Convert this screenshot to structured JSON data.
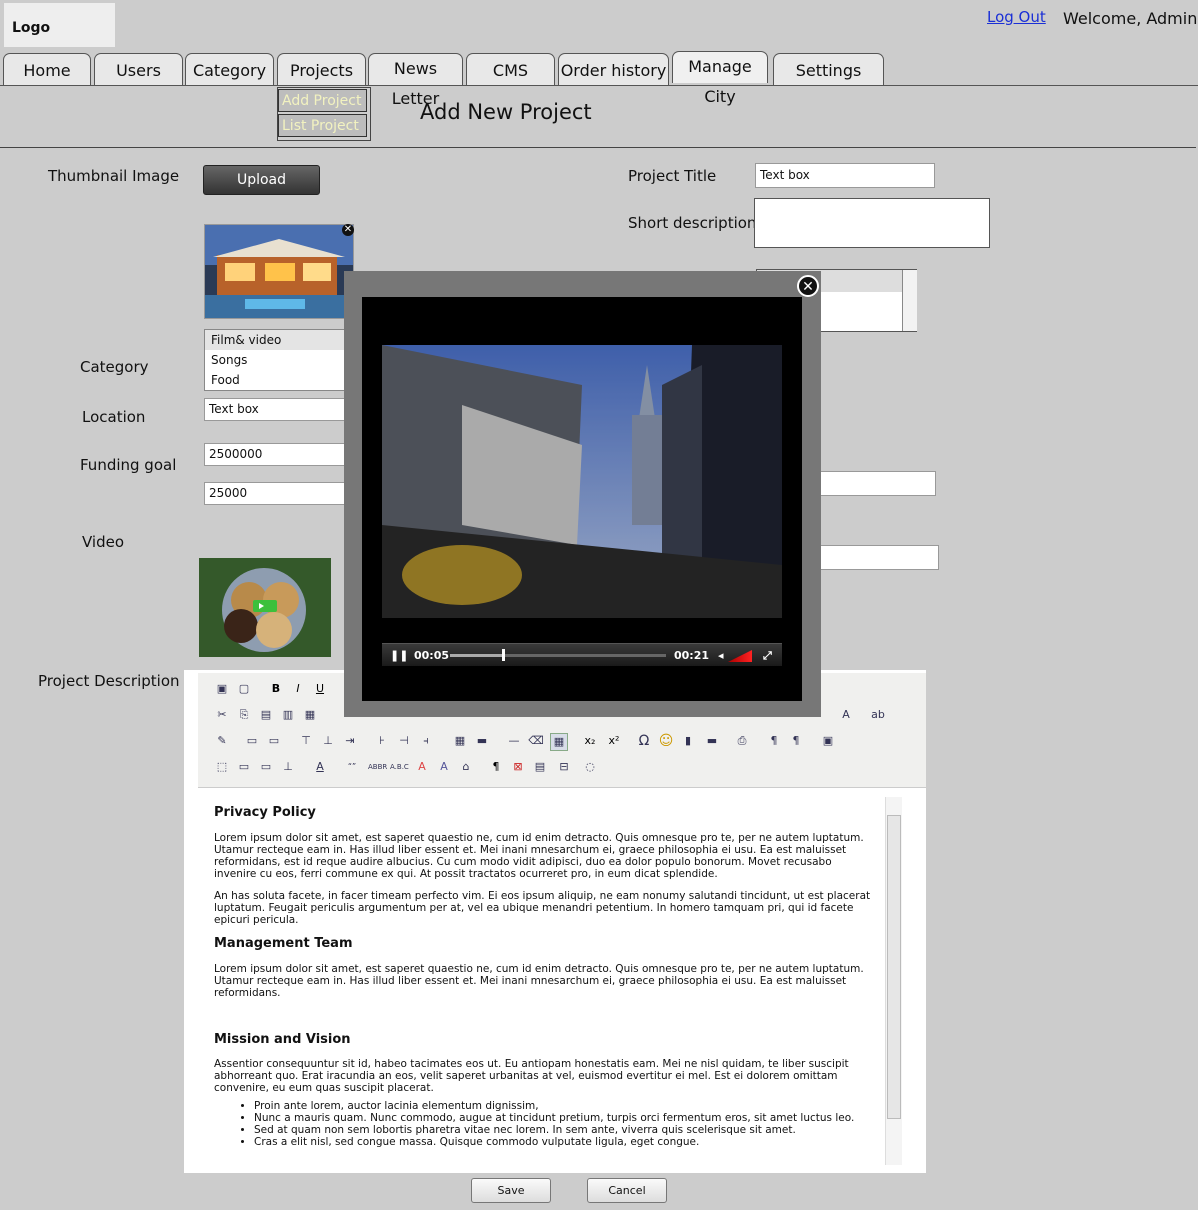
{
  "header": {
    "logo": "Logo",
    "logout": "Log Out",
    "welcome": "Welcome, Admin"
  },
  "nav": {
    "tabs": [
      "Home",
      "Users",
      "Category",
      "Projects",
      "News Letter",
      "CMS",
      "Order history",
      "Manage City",
      "Settings"
    ],
    "submenu": [
      "Add Project",
      "List Project"
    ]
  },
  "page": {
    "title": "Add New Project"
  },
  "form": {
    "thumbnail_label": "Thumbnail Image",
    "upload_label": "Upload",
    "project_title_label": "Project Title",
    "project_title_value": "Text box",
    "short_desc_label": "Short description",
    "category_label": "Category",
    "category_options": [
      "Film& video",
      "Songs",
      "Food"
    ],
    "location_label": "Location",
    "location_value": "Text box",
    "funding_label": "Funding goal",
    "funding_value": "2500000",
    "funding_value2": "25000",
    "video_label": "Video",
    "project_desc_label": "Project Description",
    "save_label": "Save",
    "cancel_label": "Cancel"
  },
  "editor": {
    "h1": "Privacy Policy",
    "p1": "Lorem ipsum dolor sit amet, est saperet quaestio ne, cum id enim detracto. Quis omnesque pro te, per ne autem luptatum. Utamur recteque eam in. Has illud liber essent et. Mei inani mnesarchum ei, graece philosophia ei usu. Ea est maluisset reformidans, est id reque audire albucius. Cu cum modo vidit adipisci, duo ea dolor populo bonorum. Movet recusabo invenire cu eos, ferri commune ex qui. At possit tractatos ocurreret pro, in eum dicat splendide.",
    "p2": "An has soluta facete, in facer timeam perfecto vim. Ei eos ipsum aliquip, ne eam nonumy salutandi tincidunt, ut est placerat luptatum. Feugait periculis argumentum per at, vel ea ubique menandri petentium. In homero tamquam pri, qui id facete epicuri pericula.",
    "h2": "Management Team",
    "p3": "Lorem ipsum dolor sit amet, est saperet quaestio ne, cum id enim detracto. Quis omnesque pro te, per ne autem luptatum. Utamur recteque eam in. Has illud liber essent et. Mei inani mnesarchum ei, graece philosophia ei usu. Ea est maluisset reformidans.",
    "h3": "Mission and Vision",
    "p4": "Assentior consequuntur sit id, habeo tacimates eos ut. Eu antiopam honestatis eam. Mei ne nisl quidam, te liber suscipit abhorreant quo. Erat iracundia an eos, velit saperet urbanitas at vel, euismod evertitur ei mel. Est ei dolorem omittam convenire, eu eum quas suscipit placerat.",
    "bullets": [
      "Proin ante lorem, auctor lacinia elementum dignissim,",
      "Nunc a mauris quam. Nunc commodo, augue at tincidunt pretium, turpis orci fermentum eros, sit amet luctus leo.",
      "Sed at quam non sem lobortis pharetra vitae nec lorem. In sem ante, viverra quis scelerisque sit amet.",
      "Cras a elit nisl, sed congue massa. Quisque commodo vulputate ligula, eget congue."
    ]
  },
  "video_player": {
    "current_time": "00:05",
    "duration": "00:21",
    "progress": 0.24
  }
}
